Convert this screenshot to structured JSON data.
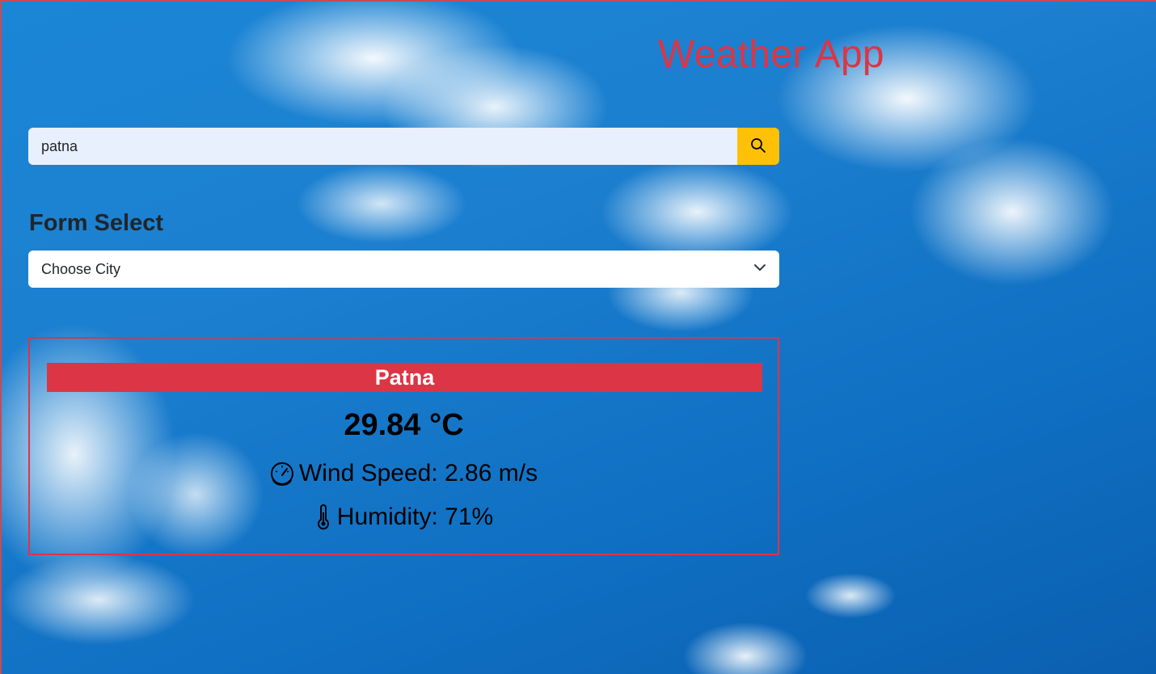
{
  "header": {
    "title": "Weather App"
  },
  "search": {
    "value": "patna",
    "button_icon": "search-icon"
  },
  "form": {
    "label": "Form Select",
    "select_value": "Choose City",
    "select_icon": "chevron-down-icon"
  },
  "weather": {
    "city": "Patna",
    "temperature": "29.84 °C",
    "wind_icon": "speedometer-icon",
    "wind": "Wind Speed: 2.86 m/s",
    "humidity_icon": "thermometer-icon",
    "humidity": "Humidity: 71%"
  },
  "colors": {
    "accent": "#dc3545",
    "search_button": "#ffc107",
    "input_bg": "#e8f0fe",
    "sky": "#1b86d6"
  }
}
